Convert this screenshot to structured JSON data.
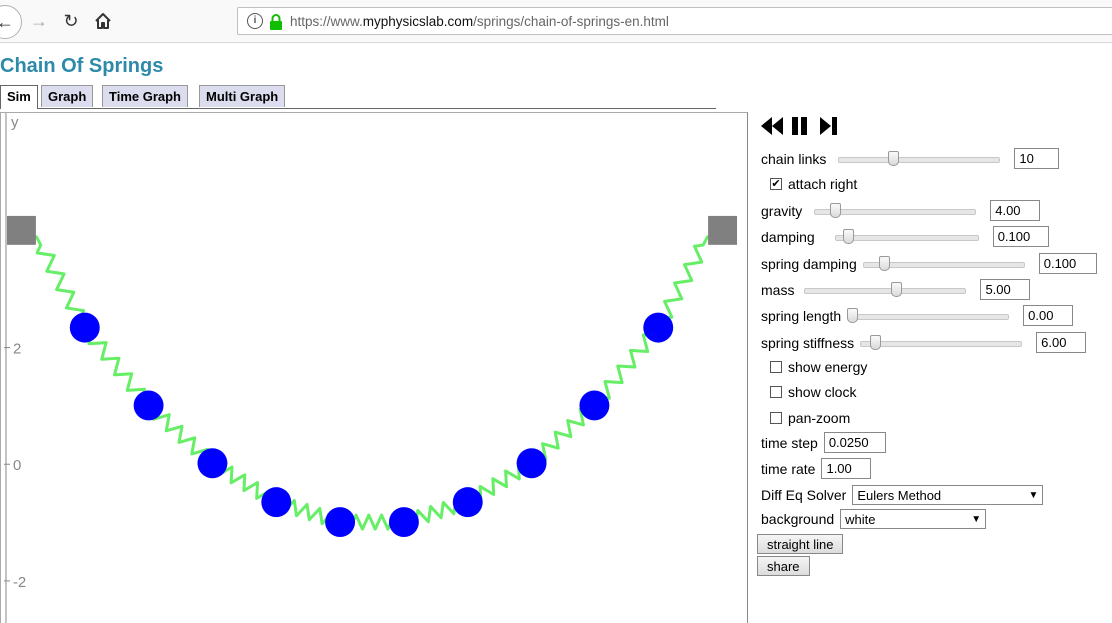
{
  "browser": {
    "url_prefix": "https://www.",
    "url_host": "myphysicslab.com",
    "url_path": "/springs/chain-of-springs-en.html"
  },
  "page": {
    "title": "Chain Of Springs",
    "tabs": [
      "Sim",
      "Graph",
      "Time Graph",
      "Multi Graph"
    ],
    "active_tab": "Sim"
  },
  "sim": {
    "axis_label": "y",
    "ticks": [
      "2",
      "0",
      "-2"
    ],
    "colors": {
      "mass": "#0000ff",
      "spring": "#66ee66",
      "anchor": "#808080"
    }
  },
  "controls": {
    "chain_links": {
      "label": "chain links",
      "value": "10"
    },
    "attach_right": {
      "label": "attach right",
      "checked": true
    },
    "gravity": {
      "label": "gravity",
      "value": "4.00"
    },
    "damping": {
      "label": "damping",
      "value": "0.100"
    },
    "spring_damping": {
      "label": "spring damping",
      "value": "0.100"
    },
    "mass": {
      "label": "mass",
      "value": "5.00"
    },
    "spring_length": {
      "label": "spring length",
      "value": "0.00"
    },
    "spring_stiffness": {
      "label": "spring stiffness",
      "value": "6.00"
    },
    "show_energy": {
      "label": "show energy",
      "checked": false
    },
    "show_clock": {
      "label": "show clock",
      "checked": false
    },
    "pan_zoom": {
      "label": "pan-zoom",
      "checked": false
    },
    "time_step": {
      "label": "time step",
      "value": "0.0250"
    },
    "time_rate": {
      "label": "time rate",
      "value": "1.00"
    },
    "diff_eq_solver": {
      "label": "Diff Eq Solver",
      "value": "Eulers Method"
    },
    "background": {
      "label": "background",
      "value": "white"
    },
    "straight_line": "straight line",
    "share": "share"
  }
}
